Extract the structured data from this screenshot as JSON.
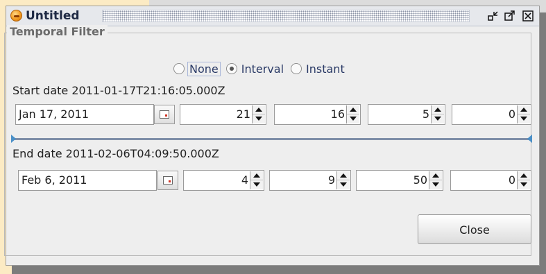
{
  "window": {
    "title": "Untitled",
    "buttons": [
      "restore-icon",
      "maximize-icon",
      "close-icon"
    ]
  },
  "panel": {
    "legend": "Temporal Filter"
  },
  "mode": {
    "options": [
      "None",
      "Interval",
      "Instant"
    ],
    "selected": "Interval"
  },
  "start": {
    "label": "Start date 2011-01-17T21:16:05.000Z",
    "date": "Jan 17, 2011",
    "hour": "21",
    "minute": "16",
    "second": "5",
    "millis": "0"
  },
  "end": {
    "label": "End date 2011-02-06T04:09:50.000Z",
    "date": "Feb 6, 2011",
    "hour": "4",
    "minute": "9",
    "second": "50",
    "millis": "0"
  },
  "slider": {
    "start_fraction": 0.0,
    "end_fraction": 1.0
  },
  "actions": {
    "close_label": "Close"
  },
  "colors": {
    "accent": "#4a90c8",
    "title_text": "#1f2a44",
    "radio_text": "#2a3a66"
  }
}
